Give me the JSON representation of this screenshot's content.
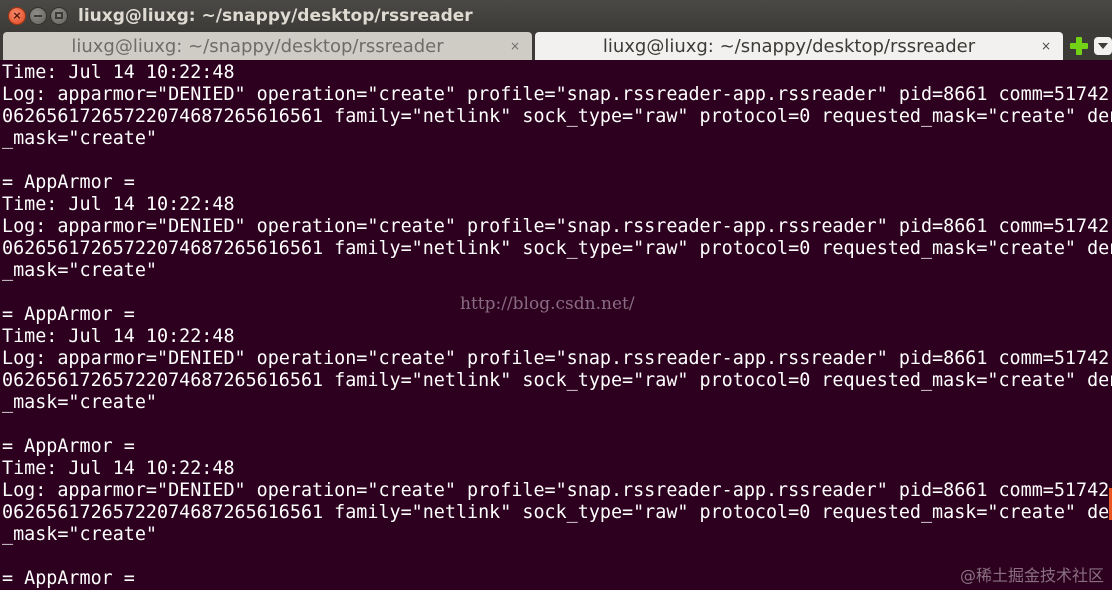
{
  "window": {
    "title": "liuxg@liuxg: ~/snappy/desktop/rssreader",
    "controls": {
      "close": "×",
      "minimize": "–",
      "maximize": "□"
    }
  },
  "tabs": [
    {
      "label": "liuxg@liuxg: ~/snappy/desktop/rssreader",
      "active": false,
      "close": "×"
    },
    {
      "label": "liuxg@liuxg: ~/snappy/desktop/rssreader",
      "active": true,
      "close": "×"
    }
  ],
  "tab_actions": {
    "new_tab_icon": "plus-icon",
    "menu_icon": "chevron-down-icon"
  },
  "terminal": {
    "lines": [
      "Time: Jul 14 10:22:48",
      "Log: apparmor=\"DENIED\" operation=\"create\" profile=\"snap.rssreader-app.rssreader\" pid=8661 comm=51742",
      "06265617265722074687265616561 family=\"netlink\" sock_type=\"raw\" protocol=0 requested_mask=\"create\" denied",
      "_mask=\"create\"",
      "",
      "= AppArmor =",
      "Time: Jul 14 10:22:48",
      "Log: apparmor=\"DENIED\" operation=\"create\" profile=\"snap.rssreader-app.rssreader\" pid=8661 comm=51742",
      "06265617265722074687265616561 family=\"netlink\" sock_type=\"raw\" protocol=0 requested_mask=\"create\" denied",
      "_mask=\"create\"",
      "",
      "= AppArmor =",
      "Time: Jul 14 10:22:48",
      "Log: apparmor=\"DENIED\" operation=\"create\" profile=\"snap.rssreader-app.rssreader\" pid=8661 comm=51742",
      "06265617265722074687265616561 family=\"netlink\" sock_type=\"raw\" protocol=0 requested_mask=\"create\" denied",
      "_mask=\"create\"",
      "",
      "= AppArmor =",
      "Time: Jul 14 10:22:48",
      "Log: apparmor=\"DENIED\" operation=\"create\" profile=\"snap.rssreader-app.rssreader\" pid=8661 comm=51742",
      "06265617265722074687265616561 family=\"netlink\" sock_type=\"raw\" protocol=0 requested_mask=\"create\" denied",
      "_mask=\"create\"",
      "",
      "= AppArmor ="
    ],
    "background": "#2c001e",
    "foreground": "#ffffff"
  },
  "watermarks": {
    "url": "http://blog.csdn.net/",
    "site": "@稀土掘金技术社区"
  }
}
